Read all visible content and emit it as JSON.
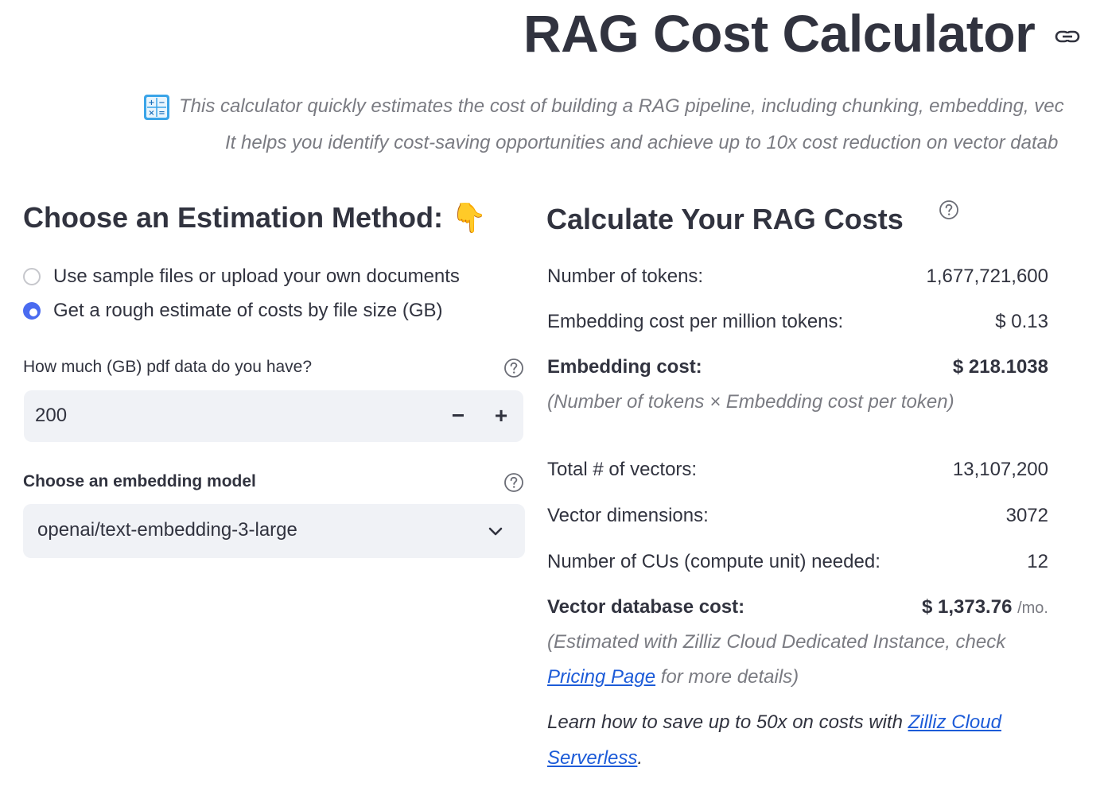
{
  "header": {
    "title": "RAG Cost Calculator",
    "intro_line1": "This calculator quickly estimates the cost of building a RAG pipeline, including chunking, embedding, vec",
    "intro_line2": "It helps you identify cost-saving opportunities and achieve up to 10x cost reduction on vector datab",
    "icons": [
      "link-icon",
      "calculator-icon"
    ]
  },
  "left": {
    "heading": "Choose an Estimation Method:",
    "heading_emoji": "👇",
    "radio_options": [
      {
        "label": "Use sample files or upload your own documents",
        "selected": false
      },
      {
        "label": "Get a rough estimate of costs by file size (GB)",
        "selected": true
      }
    ],
    "data_size": {
      "label": "How much (GB) pdf data do you have?",
      "value": "200",
      "minus": "−",
      "plus": "+"
    },
    "model": {
      "label": "Choose an embedding model",
      "selected": "openai/text-embedding-3-large"
    }
  },
  "right": {
    "heading": "Calculate Your RAG Costs",
    "rows": {
      "tokens": {
        "label": "Number of tokens:",
        "value": "1,677,721,600"
      },
      "embed_price": {
        "label": "Embedding cost per million tokens:",
        "value": "$ 0.13"
      },
      "embed_cost": {
        "label": "Embedding cost:",
        "value": "$ 218.1038"
      },
      "embed_note": "(Number of tokens × Embedding cost per token)",
      "vectors": {
        "label": "Total # of vectors:",
        "value": "13,107,200"
      },
      "dims": {
        "label": "Vector dimensions:",
        "value": "3072"
      },
      "cus": {
        "label": "Number of CUs (compute unit) needed:",
        "value": "12"
      },
      "vdb_cost": {
        "label": "Vector database cost:",
        "value": "$ 1,373.76",
        "unit": "/mo."
      }
    },
    "vdb_note_line1": "(Estimated with Zilliz Cloud Dedicated Instance, check",
    "pricing_link": "Pricing Page",
    "vdb_note_line2_rest": " for more details)",
    "learn_text": "Learn how to save up to 50x on costs with ",
    "learn_link_1": "Zilliz Cloud",
    "learn_link_2": "Serverless",
    "learn_end": "."
  },
  "colors": {
    "text": "#31333f",
    "muted": "#7a7b82",
    "accent": "#4a6bf0",
    "link": "#1c5bd8",
    "input_bg": "#f0f2f6"
  }
}
